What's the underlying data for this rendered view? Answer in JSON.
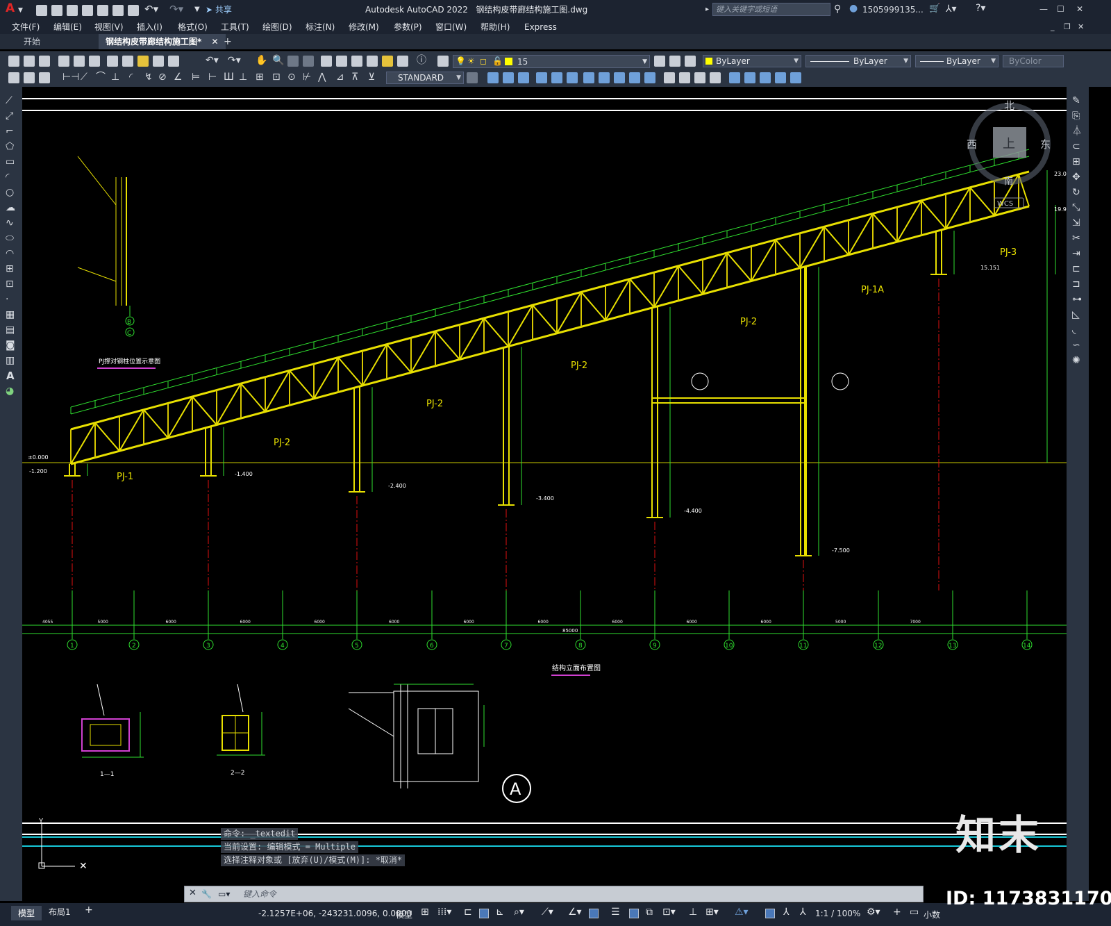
{
  "app": {
    "logo": "A",
    "title": "Autodesk AutoCAD 2022",
    "filename": "钢结构皮带廊结构施工图.dwg",
    "share_label": "共享",
    "search_placeholder": "键入关键字或短语",
    "user": "1505999135...",
    "window_buttons": [
      "—",
      "☐",
      "✕"
    ]
  },
  "menu": [
    "文件(F)",
    "编辑(E)",
    "视图(V)",
    "插入(I)",
    "格式(O)",
    "工具(T)",
    "绘图(D)",
    "标注(N)",
    "修改(M)",
    "参数(P)",
    "窗口(W)",
    "帮助(H)",
    "Express"
  ],
  "tabs": [
    {
      "label": "开始",
      "active": false
    },
    {
      "label": "钢结构皮带廊结构施工图*",
      "active": true
    }
  ],
  "toolbar": {
    "layer_value": "15",
    "color_value": "ByLayer",
    "linetype_value": "ByLayer",
    "lineweight_value": "ByLayer",
    "plotstyle_value": "ByColor",
    "textstyle_value": "STANDARD"
  },
  "viewcube": {
    "north": "北",
    "south": "南",
    "east": "东",
    "west": "西",
    "top": "上",
    "wcs": "WCS"
  },
  "drawing": {
    "main_title": "结构立面布置图",
    "detail_title": "PJ撑对钢柱位置示意图",
    "section_1": "1—1",
    "section_2": "2—2",
    "detail_a": "A",
    "truss_labels": [
      "PJ-1",
      "PJ-2",
      "PJ-2",
      "PJ-2",
      "PJ-2",
      "PJ-1A",
      "PJ-3"
    ],
    "axis_numbers": [
      "1",
      "2",
      "3",
      "4",
      "5",
      "6",
      "7",
      "8",
      "9",
      "10",
      "11",
      "12",
      "13",
      "14"
    ],
    "axis_spacings": [
      "4055",
      "5000",
      "6000",
      "6000",
      "6000",
      "6000",
      "6000",
      "6000",
      "6000",
      "6000",
      "6000",
      "5000",
      "7000"
    ],
    "overall_dim": "85000",
    "elevations": [
      "±0.000",
      "-1.200",
      "-1.400",
      "-2.400",
      "-3.400",
      "-4.400",
      "-7.500",
      "15.151",
      "23.0",
      "19.9"
    ],
    "detail_circles": [
      "B",
      "C"
    ]
  },
  "command": {
    "history": [
      "命令: _textedit",
      "当前设置: 编辑模式 = Multiple",
      "选择注释对象或 [放弃(U)/模式(M)]: *取消*"
    ],
    "placeholder": "键入命令"
  },
  "layout_tabs": [
    "模型",
    "布局1"
  ],
  "status": {
    "coords": "-2.1257E+06, -243231.0096, 0.0000",
    "model": "模型",
    "scale": "1:1 / 100%",
    "units": "小数"
  },
  "watermark": {
    "brand": "知末",
    "id": "ID: 1173831170"
  },
  "colors": {
    "background": "#000000",
    "truss": "#e8e000",
    "dimension": "#2fe02f",
    "column": "#e8e000",
    "centerline": "#e01010",
    "panel": "#2b3442"
  }
}
